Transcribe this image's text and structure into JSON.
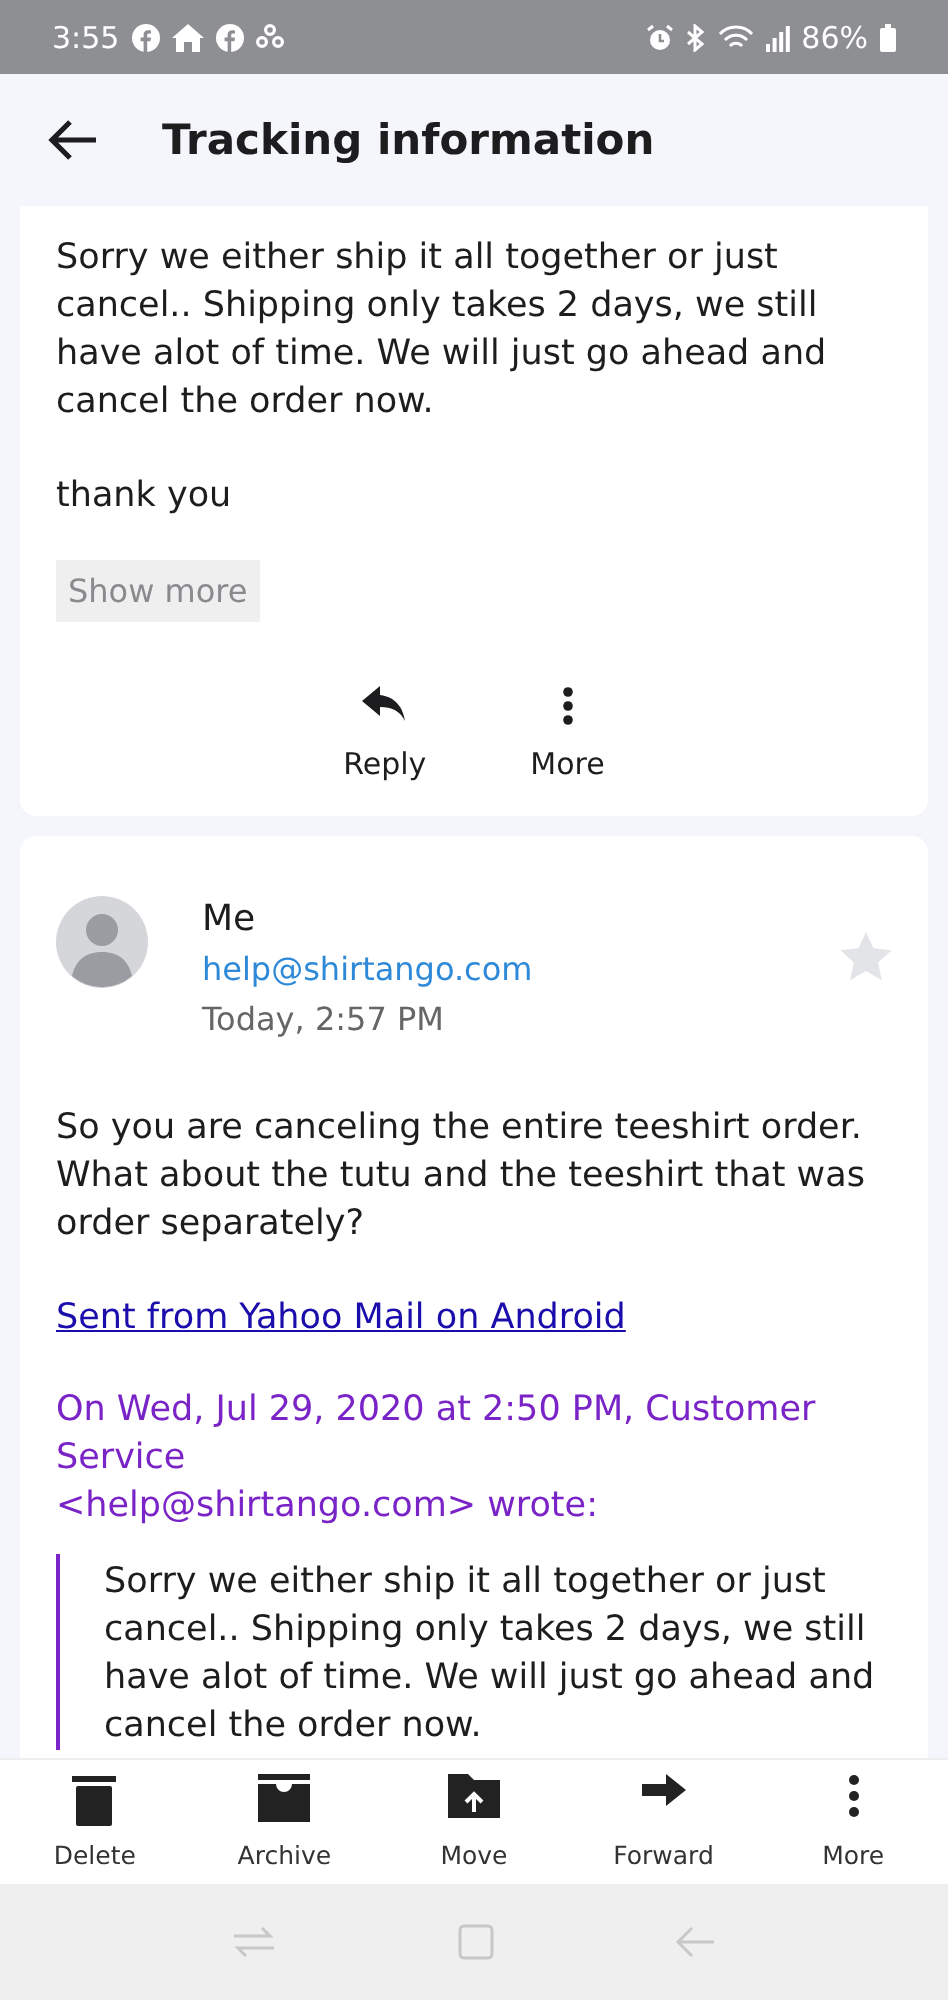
{
  "status_bar": {
    "time": "3:55",
    "battery": "86%"
  },
  "header": {
    "title": "Tracking information"
  },
  "message_1": {
    "paragraphs": [
      [
        "Sorry we either ship it all together or just",
        "cancel.. Shipping only takes 2 days, we still",
        "have alot of time. We will just go ahead and",
        "cancel the order now."
      ],
      [
        "thank you"
      ]
    ],
    "show_more": "Show more",
    "actions": [
      {
        "kind": "reply",
        "label": "Reply"
      },
      {
        "kind": "more",
        "label": "More"
      }
    ]
  },
  "message_2": {
    "sender": "Me",
    "address": "help@shirtango.com",
    "date": "Today, 2:57 PM",
    "starred": false,
    "body": [
      "So you are canceling the entire teeshirt order.",
      "What about the tutu and the teeshirt that was",
      "order separately?"
    ],
    "signature": "Sent from Yahoo Mail on Android",
    "quote_header": [
      "On Wed, Jul 29, 2020 at 2:50 PM, Customer",
      "Service",
      "<help@shirtango.com> wrote:"
    ],
    "quote": [
      "Sorry we either ship it all together or just",
      "cancel.. Shipping only takes 2 days, we still",
      "have alot of time. We will just go ahead and",
      "cancel the order now."
    ]
  },
  "toolbar": [
    {
      "kind": "delete",
      "label": "Delete"
    },
    {
      "kind": "archive",
      "label": "Archive"
    },
    {
      "kind": "move",
      "label": "Move"
    },
    {
      "kind": "forward",
      "label": "Forward"
    },
    {
      "kind": "more",
      "label": "More"
    }
  ]
}
